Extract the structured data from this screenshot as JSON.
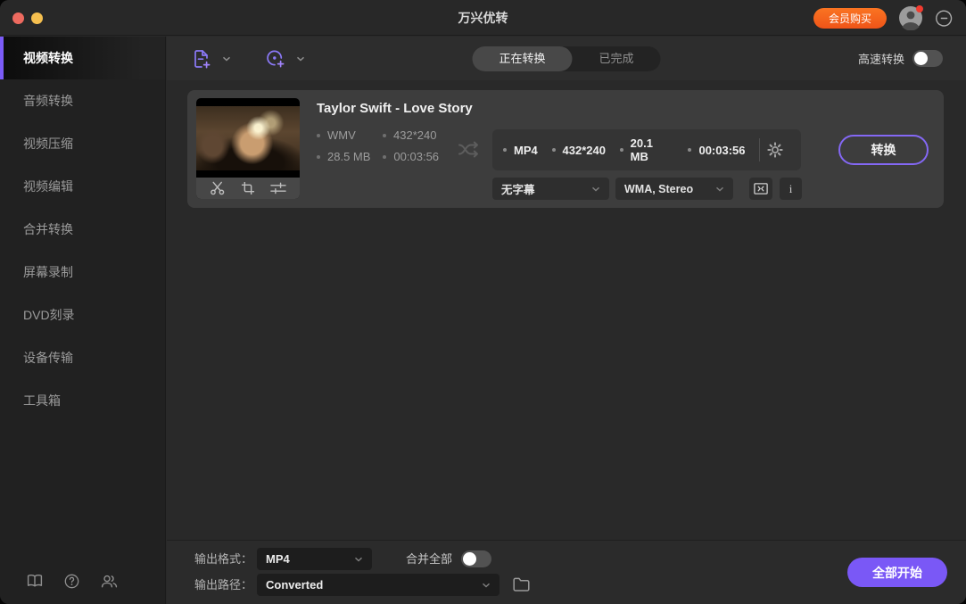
{
  "window": {
    "title": "万兴优转"
  },
  "titlebar": {
    "buy_button": "会员购买"
  },
  "sidebar": {
    "items": [
      {
        "label": "视频转换",
        "active": true
      },
      {
        "label": "音频转换",
        "active": false
      },
      {
        "label": "视频压缩",
        "active": false
      },
      {
        "label": "视频编辑",
        "active": false
      },
      {
        "label": "合并转换",
        "active": false
      },
      {
        "label": "屏幕录制",
        "active": false
      },
      {
        "label": "DVD刻录",
        "active": false
      },
      {
        "label": "设备传输",
        "active": false
      },
      {
        "label": "工具箱",
        "active": false
      }
    ]
  },
  "toolbar": {
    "tab_converting": "正在转换",
    "tab_finished": "已完成",
    "active_tab": "正在转换",
    "high_speed_label": "高速转换",
    "high_speed_enabled": false
  },
  "task": {
    "title": "Taylor Swift - Love Story",
    "source": {
      "format": "WMV",
      "resolution": "432*240",
      "size": "28.5 MB",
      "duration": "00:03:56"
    },
    "target": {
      "format": "MP4",
      "resolution": "432*240",
      "size": "20.1 MB",
      "duration": "00:03:56"
    },
    "subtitle_select": "无字幕",
    "audio_select": "WMA, Stereo",
    "info_glyph": "i",
    "convert_button": "转换"
  },
  "footer": {
    "output_format_label": "输出格式：",
    "output_format_value": "MP4",
    "merge_all_label": "合并全部",
    "merge_all_enabled": false,
    "output_path_label": "输出路径：",
    "output_path_value": "Converted",
    "start_all_button": "全部开始"
  },
  "colors": {
    "accent_purple": "#7b5bf7",
    "buy_orange": "#f5621c",
    "window_bg": "#292929",
    "card_bg": "#3d3d3d"
  }
}
